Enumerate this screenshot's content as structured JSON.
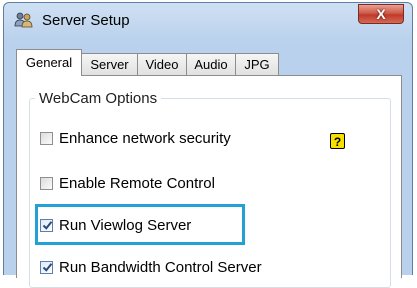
{
  "window": {
    "title": "Server Setup",
    "app_icon": "users-icon",
    "close_label": "X"
  },
  "tabs": [
    {
      "label": "General",
      "active": true
    },
    {
      "label": "Server",
      "active": false
    },
    {
      "label": "Video",
      "active": false
    },
    {
      "label": "Audio",
      "active": false
    },
    {
      "label": "JPG",
      "active": false
    }
  ],
  "group": {
    "label": "WebCam Options"
  },
  "options": [
    {
      "label": "Enhance network security",
      "checked": false
    },
    {
      "label": "Enable Remote Control",
      "checked": false
    },
    {
      "label": "Run Viewlog Server",
      "checked": true
    },
    {
      "label": "Run Bandwidth Control Server",
      "checked": true
    }
  ],
  "help": {
    "label": "?",
    "icon": "help-icon"
  },
  "colors": {
    "highlight": "#22a0d8",
    "titlebar": "#b9d1ec",
    "close": "#c0392b"
  }
}
